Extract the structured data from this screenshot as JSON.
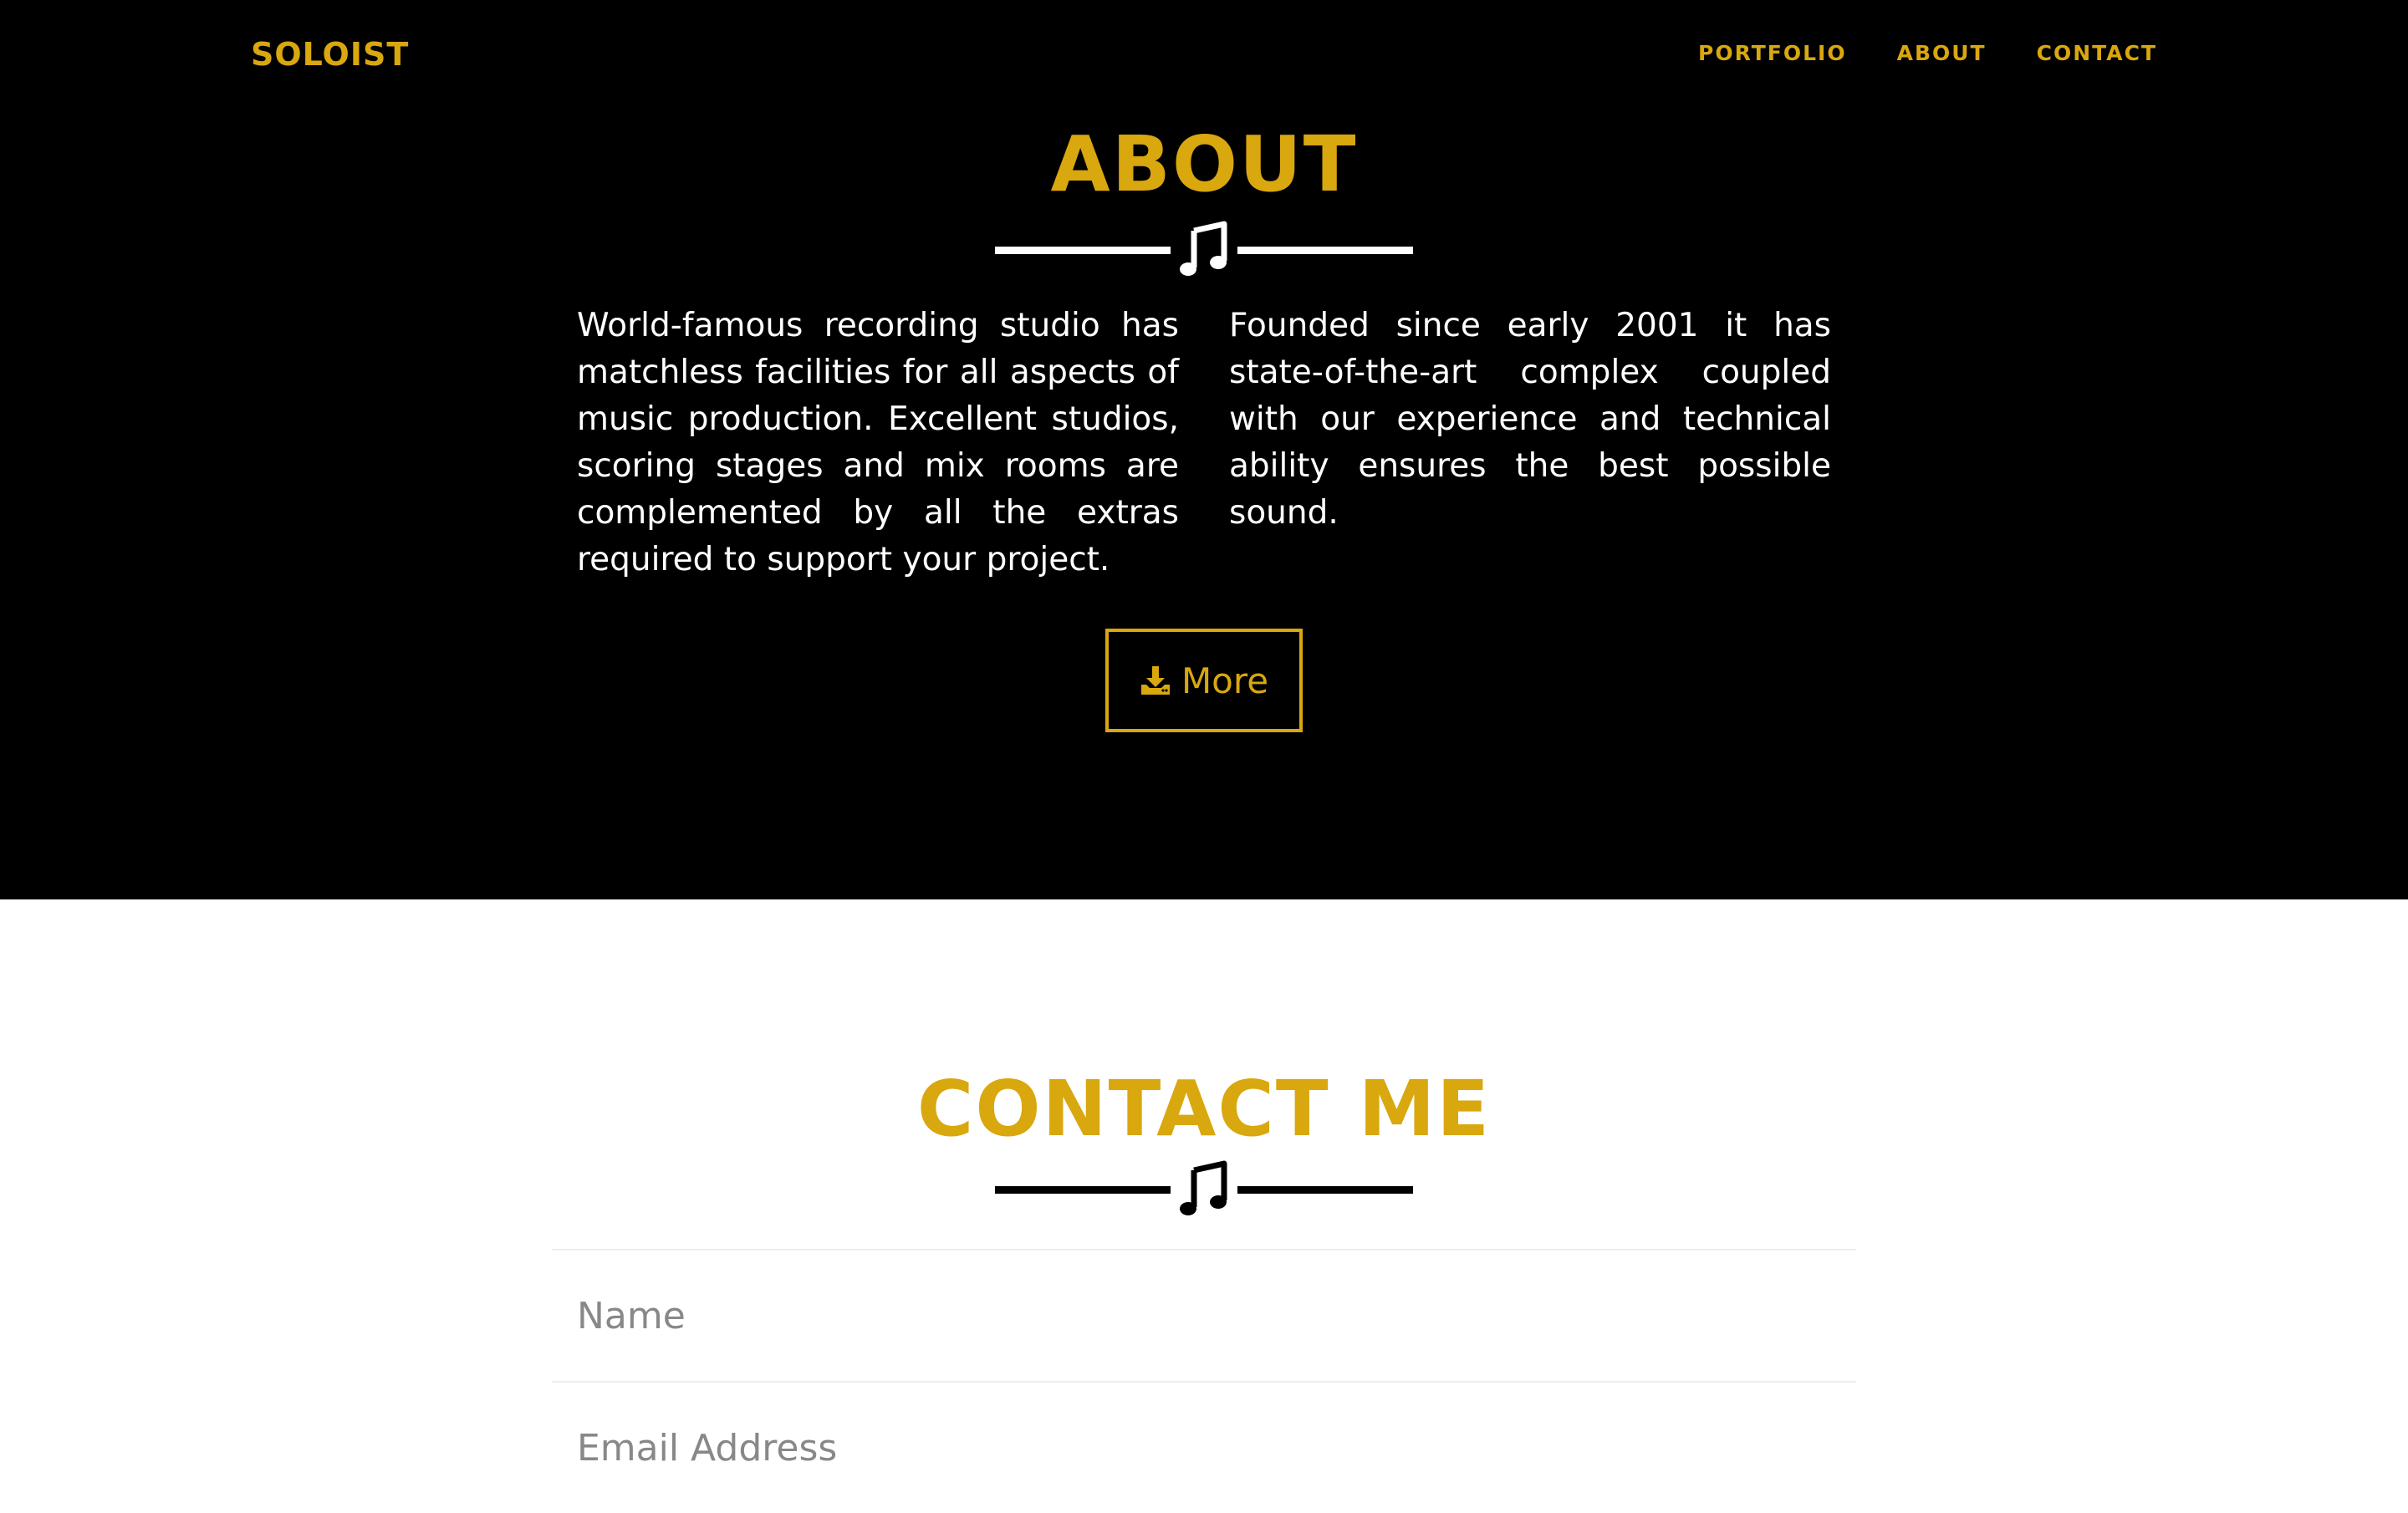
{
  "navbar": {
    "brand": "SOLOIST",
    "links": [
      "PORTFOLIO",
      "ABOUT",
      "CONTACT"
    ]
  },
  "about": {
    "title": "ABOUT",
    "paragraph_left": "World-famous recording studio has matchless facilities for all aspects of music production. Excellent studios, scoring stages and mix rooms are complemented by all the extras required to support your project.",
    "paragraph_right": "Founded since early 2001 it has state-of-the-art complex coupled with our experience and technical ability ensures the best possible sound.",
    "more_button_label": "More",
    "more_button_icon": "download-icon",
    "divider_icon": "music-note-icon"
  },
  "contact": {
    "title": "CONTACT ME",
    "divider_icon": "music-note-icon",
    "name_placeholder": "Name",
    "email_placeholder": "Email Address"
  },
  "colors": {
    "accent": "#d9a70e",
    "dark_background": "#000000",
    "light_background": "#ffffff"
  }
}
